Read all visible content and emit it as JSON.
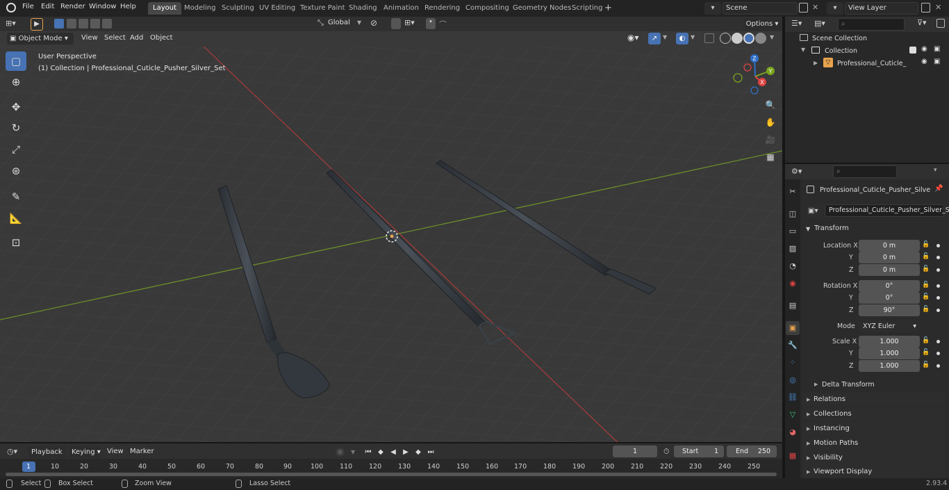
{
  "menus": [
    "File",
    "Edit",
    "Render",
    "Window",
    "Help"
  ],
  "workspaces": [
    "Layout",
    "Modeling",
    "Sculpting",
    "UV Editing",
    "Texture Paint",
    "Shading",
    "Animation",
    "Rendering",
    "Compositing",
    "Geometry Nodes",
    "Scripting"
  ],
  "active_workspace": "Layout",
  "scene": {
    "name": "Scene",
    "view_layer": "View Layer"
  },
  "toolbar": {
    "orientation": "Global",
    "options": "Options"
  },
  "viewport_header": {
    "mode": "Object Mode",
    "menus": [
      "View",
      "Select",
      "Add",
      "Object"
    ]
  },
  "viewport": {
    "perspective_label": "User Perspective",
    "collection_label": "(1) Collection | Professional_Cuticle_Pusher_Silver_Set"
  },
  "gizmo_axes": {
    "x": "X",
    "y": "Y",
    "z": "Z"
  },
  "outliner": {
    "scene_collection": "Scene Collection",
    "collection": "Collection",
    "object": "Professional_Cuticle_Pusl"
  },
  "properties": {
    "object_name_header": "Professional_Cuticle_Pusher_Silver_S...",
    "object_name_field": "Professional_Cuticle_Pusher_Silver_Set",
    "transform_title": "Transform",
    "location_label": "Location X",
    "rotation_label": "Rotation X",
    "scale_label": "Scale X",
    "y_label": "Y",
    "z_label": "Z",
    "mode_label": "Mode",
    "location": [
      "0 m",
      "0 m",
      "0 m"
    ],
    "rotation": [
      "0°",
      "0°",
      "90°"
    ],
    "rotation_mode": "XYZ Euler",
    "scale": [
      "1.000",
      "1.000",
      "1.000"
    ],
    "delta_transform": "Delta Transform",
    "panels": [
      "Relations",
      "Collections",
      "Instancing",
      "Motion Paths",
      "Visibility",
      "Viewport Display"
    ]
  },
  "timeline": {
    "menus": [
      "Playback",
      "Keying",
      "View",
      "Marker"
    ],
    "current_frame": "1",
    "start_label": "Start",
    "start": "1",
    "end_label": "End",
    "end": "250",
    "ticks": [
      "1",
      "10",
      "20",
      "30",
      "40",
      "50",
      "60",
      "70",
      "80",
      "90",
      "100",
      "110",
      "120",
      "130",
      "140",
      "150",
      "160",
      "170",
      "180",
      "190",
      "200",
      "210",
      "220",
      "230",
      "240",
      "250"
    ]
  },
  "statusbar": {
    "select": "Select",
    "box_select": "Box Select",
    "zoom_view": "Zoom View",
    "lasso_select": "Lasso Select",
    "version": "2.93.4"
  },
  "colors": {
    "accent": "#4772b3",
    "x_axis": "#c83c3c",
    "y_axis": "#7ca52d",
    "object_orange": "#e8a34d"
  }
}
